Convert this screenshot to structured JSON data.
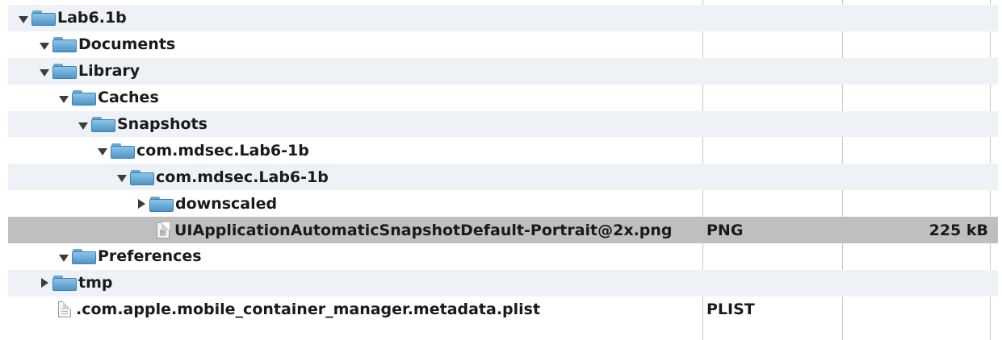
{
  "rows": [
    {
      "name": "Lab6.1b",
      "kind": "",
      "size": ""
    },
    {
      "name": "Documents",
      "kind": "",
      "size": ""
    },
    {
      "name": "Library",
      "kind": "",
      "size": ""
    },
    {
      "name": "Caches",
      "kind": "",
      "size": ""
    },
    {
      "name": "Snapshots",
      "kind": "",
      "size": ""
    },
    {
      "name": "com.mdsec.Lab6-1b",
      "kind": "",
      "size": ""
    },
    {
      "name": "com.mdsec.Lab6-1b",
      "kind": "",
      "size": ""
    },
    {
      "name": "downscaled",
      "kind": "",
      "size": ""
    },
    {
      "name": "UIApplicationAutomaticSnapshotDefault-Portrait@2x.png",
      "kind": "PNG",
      "size": "225 kB"
    },
    {
      "name": "Preferences",
      "kind": "",
      "size": ""
    },
    {
      "name": "tmp",
      "kind": "",
      "size": ""
    },
    {
      "name": ".com.apple.mobile_container_manager.metadata.plist",
      "kind": "PLIST",
      "size": ""
    }
  ],
  "colors": {
    "row_alt": "#eef2f7",
    "row_selected": "#bfbfbf",
    "folder": "#5fa2d3"
  }
}
